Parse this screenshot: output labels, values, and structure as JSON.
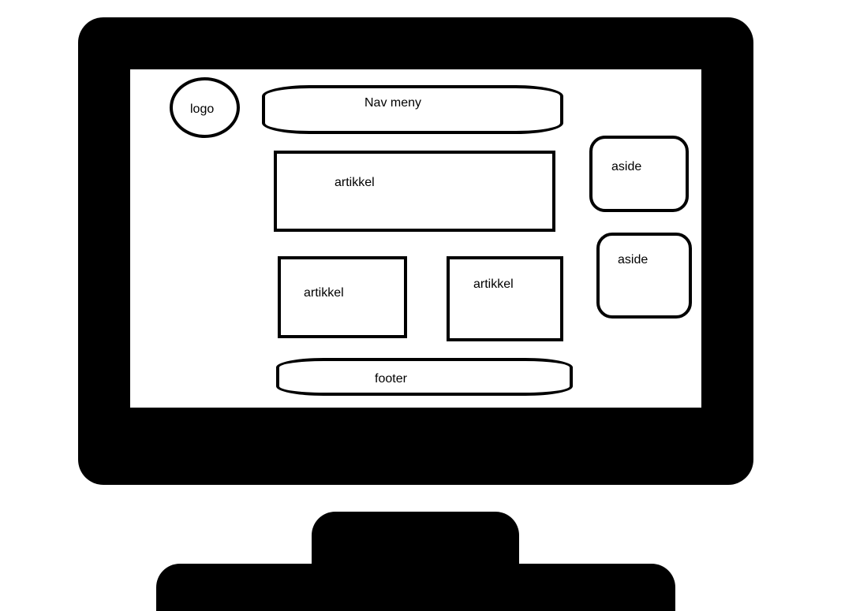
{
  "wireframe": {
    "logo": "logo",
    "nav": "Nav meny",
    "articles": [
      "artikkel",
      "artikkel",
      "artikkel"
    ],
    "asides": [
      "aside",
      "aside"
    ],
    "footer": "footer"
  }
}
